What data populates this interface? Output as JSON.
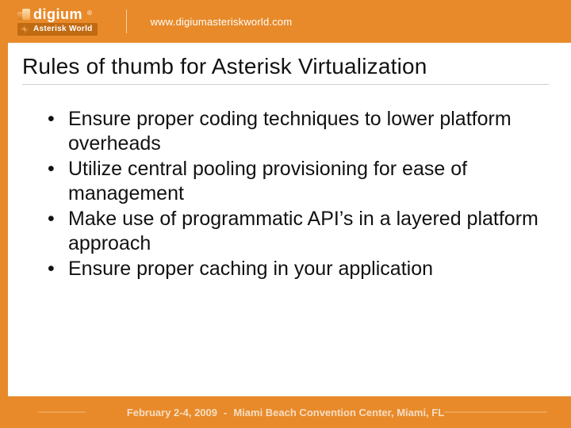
{
  "header": {
    "brand_word": "digium",
    "brand_reg": "®",
    "sub_brand": "Asterisk World",
    "site_url": "www.digiumasteriskworld.com"
  },
  "slide": {
    "title": "Rules of thumb for Asterisk Virtualization",
    "bullets": [
      "Ensure proper coding techniques to lower platform overheads",
      "Utilize central pooling provisioning for ease of management",
      "Make use of programmatic API’s in a layered platform approach",
      "Ensure proper caching in your application"
    ]
  },
  "footer": {
    "dates": "February 2-4, 2009",
    "sep": "-",
    "venue": "Miami Beach Convention Center, Miami, FL"
  }
}
